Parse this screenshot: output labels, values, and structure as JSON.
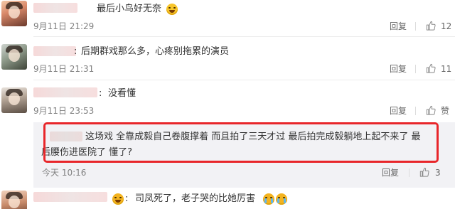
{
  "comments": [
    {
      "text": "最后小鸟好无奈",
      "time": "9月11日 21:29",
      "reply_label": "回复",
      "like_count": "12"
    },
    {
      "text": "后期群戏那么多，心疼别拖累的演员",
      "time": "9月11日 21:31",
      "reply_label": "回复",
      "like_count": "11"
    },
    {
      "text": "没看懂",
      "time": "9月11日 23:53",
      "reply_label": "回复",
      "like_count": "赞"
    },
    {
      "text": "司凤死了，老子哭的比她厉害"
    }
  ],
  "sub_reply": {
    "line1": "这场戏 全靠成毅自己卷腹撑着 而且拍了三天才过 最后拍完成毅躺地上起不来了 最",
    "line2": "后腰伤进医院了 懂了?",
    "time": "今天 10:16",
    "reply_label": "回复",
    "like_count": "3"
  },
  "colon": ":",
  "icons": {
    "like": "thumbs-up-icon",
    "emoji_laugh": "grinning-face-emoji",
    "emoji_cry": "crying-face-emoji",
    "emoji_tears": "loudly-crying-face-emoji"
  },
  "colors": {
    "highlight": "#e8262a",
    "panel": "#f2f2f5",
    "meta_text": "#808080"
  }
}
